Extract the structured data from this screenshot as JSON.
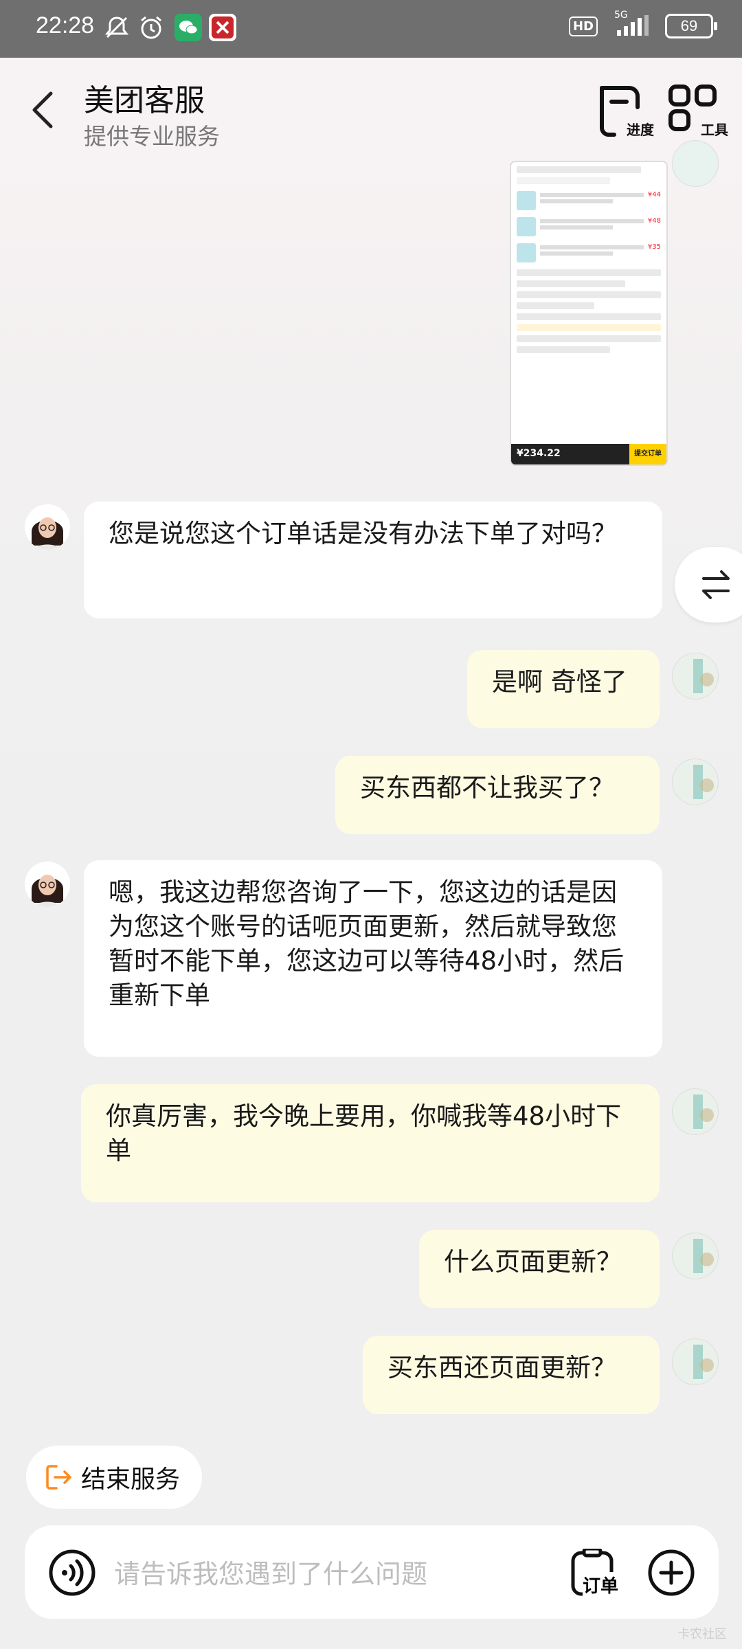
{
  "status_bar": {
    "time": "22:28",
    "network": "5G",
    "hd": "HD",
    "battery": "69"
  },
  "header": {
    "title": "美团客服",
    "subtitle": "提供专业服务",
    "progress_label": "进度",
    "tools_label": "工具"
  },
  "shared_screenshot": {
    "total": "¥234.22",
    "pay_label": "提交订单"
  },
  "messages": [
    {
      "from": "agent",
      "text": "您是说您这个订单话是没有办法下单了对吗？"
    },
    {
      "from": "user",
      "text": "是啊 奇怪了"
    },
    {
      "from": "user",
      "text": "买东西都不让我买了？"
    },
    {
      "from": "agent",
      "text": "嗯，我这边帮您咨询了一下，您这边的话是因为您这个账号的话呃页面更新，然后就导致您暂时不能下单，您这边可以等待48小时，然后重新下单"
    },
    {
      "from": "user",
      "text": "你真厉害，我今晚上要用，你喊我等48小时下单"
    },
    {
      "from": "user",
      "text": "什么页面更新？"
    },
    {
      "from": "user",
      "text": "买东西还页面更新？"
    }
  ],
  "end_service": {
    "label": "结束服务"
  },
  "input": {
    "placeholder": "请告诉我您遇到了什么问题",
    "order_label": "订单"
  },
  "watermark": "卡农社区",
  "colors": {
    "user_bubble": "#fefbe3",
    "agent_bubble": "#ffffff",
    "accent": "#ff8a1f"
  }
}
